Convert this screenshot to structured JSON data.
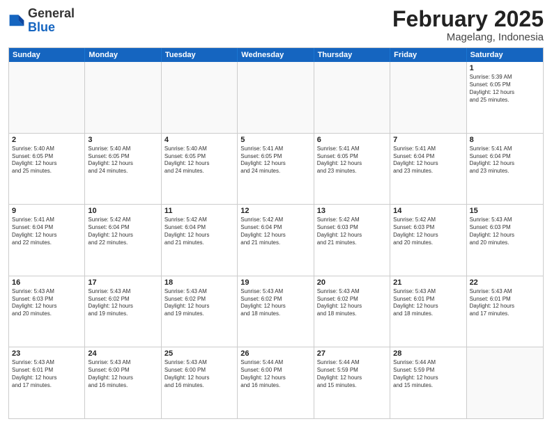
{
  "logo": {
    "general": "General",
    "blue": "Blue"
  },
  "header": {
    "month": "February 2025",
    "location": "Magelang, Indonesia"
  },
  "weekdays": [
    "Sunday",
    "Monday",
    "Tuesday",
    "Wednesday",
    "Thursday",
    "Friday",
    "Saturday"
  ],
  "rows": [
    [
      {
        "day": "",
        "info": ""
      },
      {
        "day": "",
        "info": ""
      },
      {
        "day": "",
        "info": ""
      },
      {
        "day": "",
        "info": ""
      },
      {
        "day": "",
        "info": ""
      },
      {
        "day": "",
        "info": ""
      },
      {
        "day": "1",
        "info": "Sunrise: 5:39 AM\nSunset: 6:05 PM\nDaylight: 12 hours\nand 25 minutes."
      }
    ],
    [
      {
        "day": "2",
        "info": "Sunrise: 5:40 AM\nSunset: 6:05 PM\nDaylight: 12 hours\nand 25 minutes."
      },
      {
        "day": "3",
        "info": "Sunrise: 5:40 AM\nSunset: 6:05 PM\nDaylight: 12 hours\nand 24 minutes."
      },
      {
        "day": "4",
        "info": "Sunrise: 5:40 AM\nSunset: 6:05 PM\nDaylight: 12 hours\nand 24 minutes."
      },
      {
        "day": "5",
        "info": "Sunrise: 5:41 AM\nSunset: 6:05 PM\nDaylight: 12 hours\nand 24 minutes."
      },
      {
        "day": "6",
        "info": "Sunrise: 5:41 AM\nSunset: 6:05 PM\nDaylight: 12 hours\nand 23 minutes."
      },
      {
        "day": "7",
        "info": "Sunrise: 5:41 AM\nSunset: 6:04 PM\nDaylight: 12 hours\nand 23 minutes."
      },
      {
        "day": "8",
        "info": "Sunrise: 5:41 AM\nSunset: 6:04 PM\nDaylight: 12 hours\nand 23 minutes."
      }
    ],
    [
      {
        "day": "9",
        "info": "Sunrise: 5:41 AM\nSunset: 6:04 PM\nDaylight: 12 hours\nand 22 minutes."
      },
      {
        "day": "10",
        "info": "Sunrise: 5:42 AM\nSunset: 6:04 PM\nDaylight: 12 hours\nand 22 minutes."
      },
      {
        "day": "11",
        "info": "Sunrise: 5:42 AM\nSunset: 6:04 PM\nDaylight: 12 hours\nand 21 minutes."
      },
      {
        "day": "12",
        "info": "Sunrise: 5:42 AM\nSunset: 6:04 PM\nDaylight: 12 hours\nand 21 minutes."
      },
      {
        "day": "13",
        "info": "Sunrise: 5:42 AM\nSunset: 6:03 PM\nDaylight: 12 hours\nand 21 minutes."
      },
      {
        "day": "14",
        "info": "Sunrise: 5:42 AM\nSunset: 6:03 PM\nDaylight: 12 hours\nand 20 minutes."
      },
      {
        "day": "15",
        "info": "Sunrise: 5:43 AM\nSunset: 6:03 PM\nDaylight: 12 hours\nand 20 minutes."
      }
    ],
    [
      {
        "day": "16",
        "info": "Sunrise: 5:43 AM\nSunset: 6:03 PM\nDaylight: 12 hours\nand 20 minutes."
      },
      {
        "day": "17",
        "info": "Sunrise: 5:43 AM\nSunset: 6:02 PM\nDaylight: 12 hours\nand 19 minutes."
      },
      {
        "day": "18",
        "info": "Sunrise: 5:43 AM\nSunset: 6:02 PM\nDaylight: 12 hours\nand 19 minutes."
      },
      {
        "day": "19",
        "info": "Sunrise: 5:43 AM\nSunset: 6:02 PM\nDaylight: 12 hours\nand 18 minutes."
      },
      {
        "day": "20",
        "info": "Sunrise: 5:43 AM\nSunset: 6:02 PM\nDaylight: 12 hours\nand 18 minutes."
      },
      {
        "day": "21",
        "info": "Sunrise: 5:43 AM\nSunset: 6:01 PM\nDaylight: 12 hours\nand 18 minutes."
      },
      {
        "day": "22",
        "info": "Sunrise: 5:43 AM\nSunset: 6:01 PM\nDaylight: 12 hours\nand 17 minutes."
      }
    ],
    [
      {
        "day": "23",
        "info": "Sunrise: 5:43 AM\nSunset: 6:01 PM\nDaylight: 12 hours\nand 17 minutes."
      },
      {
        "day": "24",
        "info": "Sunrise: 5:43 AM\nSunset: 6:00 PM\nDaylight: 12 hours\nand 16 minutes."
      },
      {
        "day": "25",
        "info": "Sunrise: 5:43 AM\nSunset: 6:00 PM\nDaylight: 12 hours\nand 16 minutes."
      },
      {
        "day": "26",
        "info": "Sunrise: 5:44 AM\nSunset: 6:00 PM\nDaylight: 12 hours\nand 16 minutes."
      },
      {
        "day": "27",
        "info": "Sunrise: 5:44 AM\nSunset: 5:59 PM\nDaylight: 12 hours\nand 15 minutes."
      },
      {
        "day": "28",
        "info": "Sunrise: 5:44 AM\nSunset: 5:59 PM\nDaylight: 12 hours\nand 15 minutes."
      },
      {
        "day": "",
        "info": ""
      }
    ]
  ]
}
